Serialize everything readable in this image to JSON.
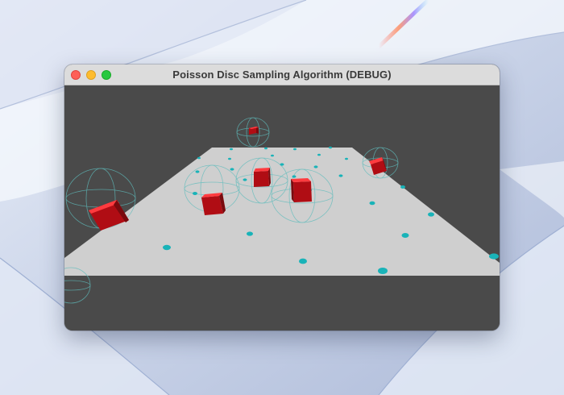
{
  "window": {
    "title": "Poisson Disc Sampling Algorithm (DEBUG)"
  },
  "icons": {
    "close": "close-icon",
    "minimize": "minimize-icon",
    "zoom": "zoom-icon"
  },
  "colors": {
    "viewport_background": "#4a4a4a",
    "ground": "#cfcfcf",
    "cube": "#e8141c",
    "point": "#19b3b8",
    "radius_wireframe": "#5fbcbc"
  }
}
